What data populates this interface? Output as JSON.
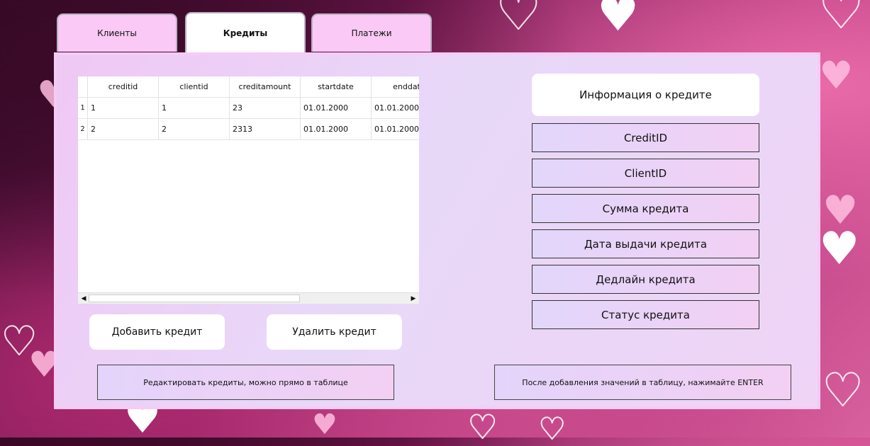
{
  "tabs": [
    {
      "label": "Клиенты",
      "active": false
    },
    {
      "label": "Кредиты",
      "active": true
    },
    {
      "label": "Платежи",
      "active": false
    }
  ],
  "table": {
    "columns": [
      "creditid",
      "clientid",
      "creditamount",
      "startdate",
      "enddat"
    ],
    "rows": [
      {
        "num": "1",
        "cells": [
          "1",
          "1",
          "23",
          "01.01.2000",
          "01.01.2000"
        ]
      },
      {
        "num": "2",
        "cells": [
          "2",
          "2",
          "2313",
          "01.01.2000",
          "01.01.2000"
        ]
      }
    ]
  },
  "buttons": {
    "add_credit": "Добавить кредит",
    "delete_credit": "Удалить кредит",
    "edit_hint": "Редактировать кредиты, можно прямо в таблице",
    "enter_hint": "После добавления значений в таблицу, нажимайте ENTER"
  },
  "info": {
    "title": "Информация о кредите",
    "fields": [
      "CreditID",
      "ClientID",
      "Сумма кредита",
      "Дата выдачи кредита",
      "Дедлайн кредита",
      "Статус кредита"
    ]
  },
  "colors": {
    "panel": "#efd4f6",
    "tab_inactive": "#fbc9f5",
    "tab_active": "#ffffff"
  }
}
